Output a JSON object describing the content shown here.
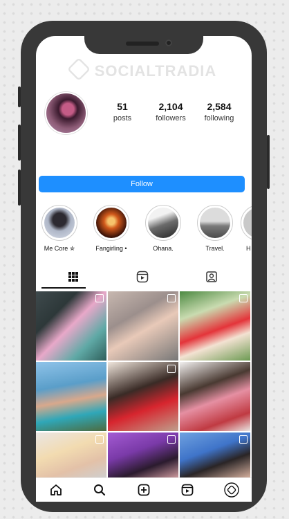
{
  "watermark": "SOCIALTRADIA",
  "profile": {
    "stats": [
      {
        "value": "51",
        "label": "posts"
      },
      {
        "value": "2,104",
        "label": "followers"
      },
      {
        "value": "2,584",
        "label": "following"
      }
    ],
    "follow_label": "Follow"
  },
  "highlights": [
    {
      "label": "Me Core ✮"
    },
    {
      "label": "Fangirling •"
    },
    {
      "label": "Ohana."
    },
    {
      "label": "Travel."
    },
    {
      "label": "H"
    }
  ],
  "tabs": [
    {
      "icon": "grid-icon"
    },
    {
      "icon": "reels-icon"
    },
    {
      "icon": "tagged-icon"
    }
  ],
  "nav": [
    {
      "icon": "home-icon"
    },
    {
      "icon": "search-icon"
    },
    {
      "icon": "add-post-icon"
    },
    {
      "icon": "reels-icon"
    },
    {
      "icon": "profile-icon"
    }
  ],
  "colors": {
    "accent": "#1e8fff",
    "phone_frame": "#383838"
  }
}
